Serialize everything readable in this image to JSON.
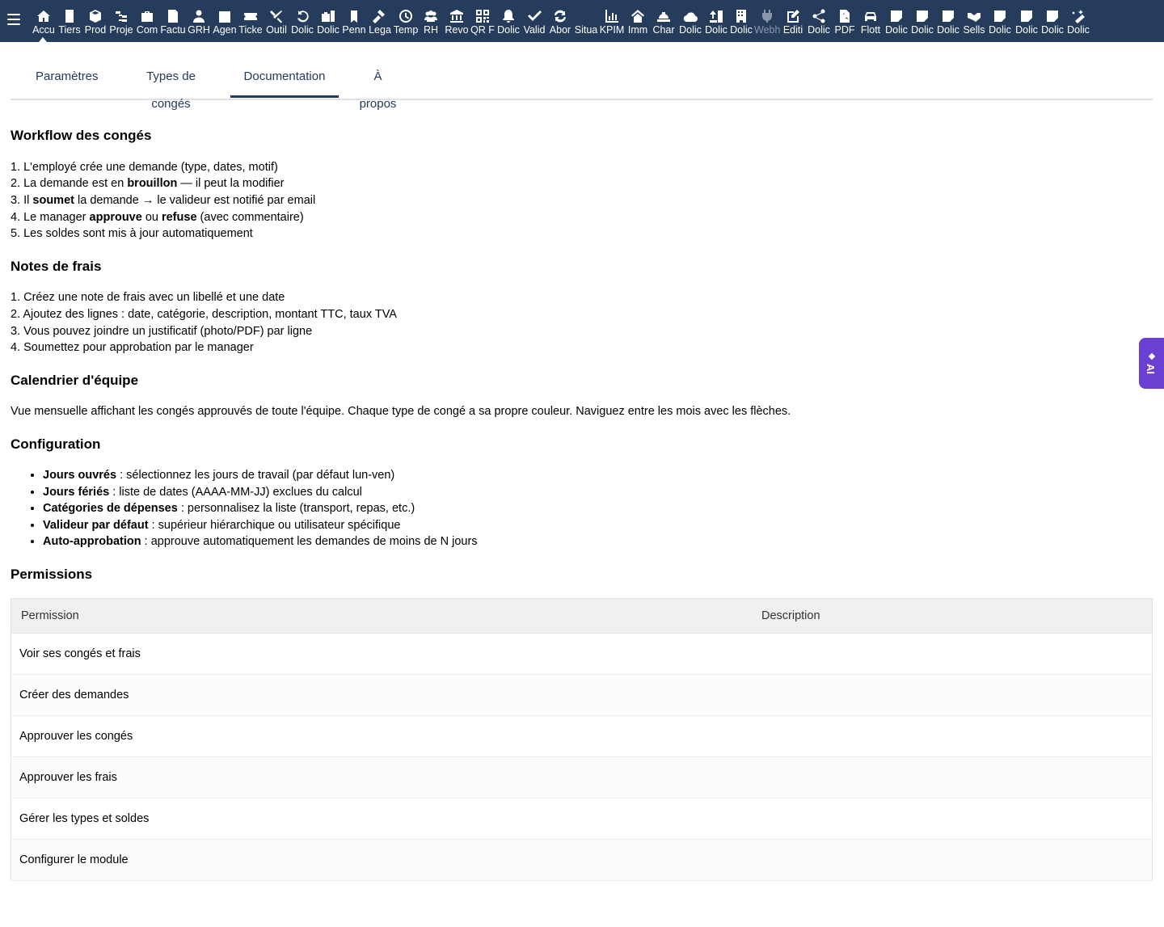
{
  "nav": {
    "items": [
      {
        "label": "Accu",
        "icon": "home-icon"
      },
      {
        "label": "Tiers",
        "icon": "building-icon"
      },
      {
        "label": "Prod",
        "icon": "box-icon"
      },
      {
        "label": "Proje",
        "icon": "sitemap-icon"
      },
      {
        "label": "Com",
        "icon": "briefcase-icon"
      },
      {
        "label": "Factu",
        "icon": "invoice-icon"
      },
      {
        "label": "GRH",
        "icon": "user-icon"
      },
      {
        "label": "Agen",
        "icon": "calendar-icon"
      },
      {
        "label": "Ticke",
        "icon": "ticket-icon"
      },
      {
        "label": "Outil",
        "icon": "tools-icon"
      },
      {
        "label": "Dolic",
        "icon": "undo-icon"
      },
      {
        "label": "Dolic",
        "icon": "suitcase-icon"
      },
      {
        "label": "Penn",
        "icon": "bookmark-icon"
      },
      {
        "label": "Lega",
        "icon": "gavel-icon"
      },
      {
        "label": "Temp",
        "icon": "clock-icon"
      },
      {
        "label": "RH",
        "icon": "users-icon"
      },
      {
        "label": "Revo",
        "icon": "bank-icon"
      },
      {
        "label": "QR F",
        "icon": "qrcode-icon"
      },
      {
        "label": "Dolic",
        "icon": "bell-icon"
      },
      {
        "label": "Valid",
        "icon": "check-double-icon"
      },
      {
        "label": "Abor",
        "icon": "sync-icon"
      },
      {
        "label": "Situa",
        "icon": "blank-icon"
      },
      {
        "label": "KPIM",
        "icon": "bar-chart-icon"
      },
      {
        "label": "Imm",
        "icon": "house-icon"
      },
      {
        "label": "Char",
        "icon": "hardhat-icon"
      },
      {
        "label": "Dolic",
        "icon": "cloud-icon"
      },
      {
        "label": "Dolic",
        "icon": "upload-icon"
      },
      {
        "label": "Dolic",
        "icon": "office-building-icon"
      },
      {
        "label": "Webh",
        "icon": "plug-icon",
        "dim": true
      },
      {
        "label": "Editi",
        "icon": "edit-icon"
      },
      {
        "label": "Dolic",
        "icon": "share-icon"
      },
      {
        "label": "PDF",
        "icon": "pdf-icon"
      },
      {
        "label": "Flott",
        "icon": "car-icon"
      },
      {
        "label": "Dolic",
        "icon": "note-icon"
      },
      {
        "label": "Dolic",
        "icon": "note-icon"
      },
      {
        "label": "Dolic",
        "icon": "note-icon"
      },
      {
        "label": "Sells",
        "icon": "handshake-icon"
      },
      {
        "label": "Dolic",
        "icon": "note-icon"
      },
      {
        "label": "Dolic",
        "icon": "note-icon"
      },
      {
        "label": "Dolic",
        "icon": "note-icon"
      },
      {
        "label": "Dolic",
        "icon": "magic-wand-icon"
      }
    ]
  },
  "tabs": [
    {
      "label": "Paramètres"
    },
    {
      "label": "Types de congés"
    },
    {
      "label": "Documentation",
      "active": true
    },
    {
      "label": "À propos"
    }
  ],
  "doc": {
    "workflow": {
      "title": "Workflow des congés",
      "steps": [
        {
          "pre": "1. L'employé crée une demande (type, dates, motif)",
          "b1": "",
          "mid": "",
          "b2": "",
          "post": ""
        },
        {
          "pre": "2. La demande est en ",
          "b1": "brouillon",
          "mid": " — il peut la modifier",
          "b2": "",
          "post": ""
        },
        {
          "pre": "3. Il ",
          "b1": "soumet",
          "mid": " la demande → le valideur est notifié par email",
          "b2": "",
          "post": ""
        },
        {
          "pre": "4. Le manager ",
          "b1": "approuve",
          "mid": " ou ",
          "b2": "refuse",
          "post": " (avec commentaire)"
        },
        {
          "pre": "5. Les soldes sont mis à jour automatiquement",
          "b1": "",
          "mid": "",
          "b2": "",
          "post": ""
        }
      ]
    },
    "expenses": {
      "title": "Notes de frais",
      "steps": [
        "1. Créez une note de frais avec un libellé et une date",
        "2. Ajoutez des lignes : date, catégorie, description, montant TTC, taux TVA",
        "3. Vous pouvez joindre un justificatif (photo/PDF) par ligne",
        "4. Soumettez pour approbation par le manager"
      ]
    },
    "calendar": {
      "title": "Calendrier d'équipe",
      "text": "Vue mensuelle affichant les congés approuvés de toute l'équipe. Chaque type de congé a sa propre couleur. Naviguez entre les mois avec les flèches."
    },
    "config": {
      "title": "Configuration",
      "items": [
        {
          "term": "Jours ouvrés",
          "desc": " : sélectionnez les jours de travail (par défaut lun-ven)"
        },
        {
          "term": "Jours fériés",
          "desc": " : liste de dates (AAAA-MM-JJ) exclues du calcul"
        },
        {
          "term": "Catégories de dépenses",
          "desc": " : personnalisez la liste (transport, repas, etc.)"
        },
        {
          "term": "Valideur par défaut",
          "desc": " : supérieur hiérarchique ou utilisateur spécifique"
        },
        {
          "term": "Auto-approbation",
          "desc": " : approuve automatiquement les demandes de moins de N jours"
        }
      ]
    },
    "permissions": {
      "title": "Permissions",
      "columns": [
        "Permission",
        "Description"
      ],
      "rows": [
        {
          "permission": "Voir ses congés et frais",
          "description": ""
        },
        {
          "permission": "Créer des demandes",
          "description": ""
        },
        {
          "permission": "Approuver les congés",
          "description": ""
        },
        {
          "permission": "Approuver les frais",
          "description": ""
        },
        {
          "permission": "Gérer les types et soldes",
          "description": ""
        },
        {
          "permission": "Configurer le module",
          "description": ""
        }
      ]
    }
  },
  "ai_button": {
    "label": "AI"
  },
  "colors": {
    "topbar": "#263c5c",
    "tab_text": "#233a5c",
    "ai_button": "#6b3fd1"
  }
}
